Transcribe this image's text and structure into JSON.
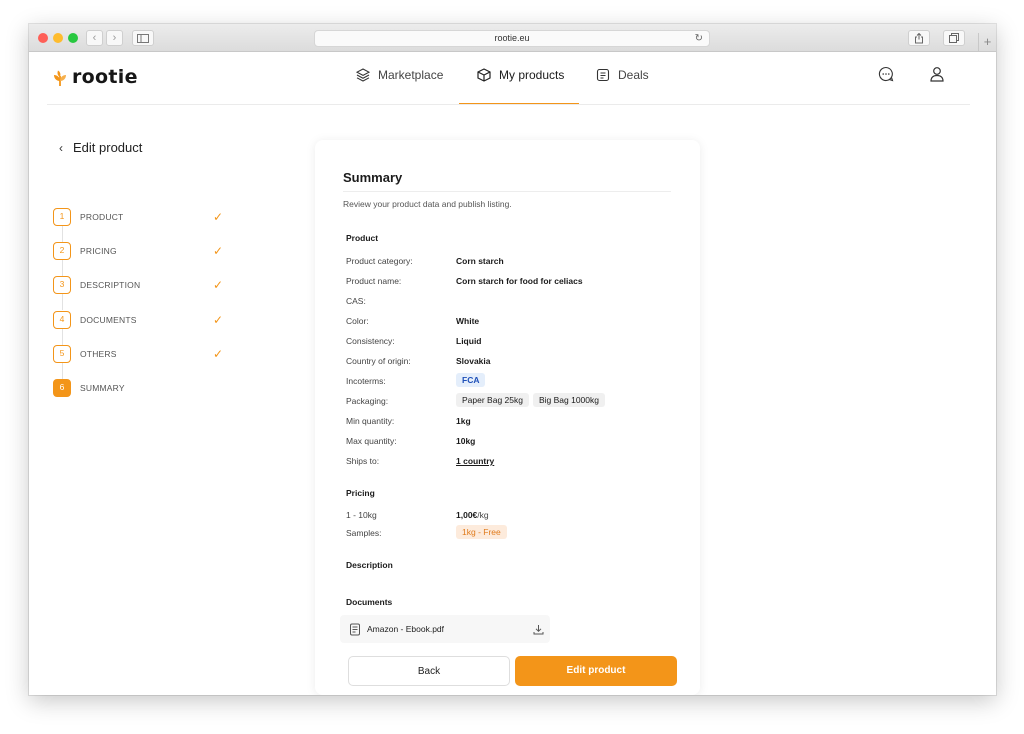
{
  "browser": {
    "url": "rootie.eu"
  },
  "header": {
    "logo_text": "rootie",
    "nav": [
      {
        "label": "Marketplace",
        "icon": "layers-icon"
      },
      {
        "label": "My products",
        "icon": "box-icon",
        "active": true
      },
      {
        "label": "Deals",
        "icon": "document-icon"
      }
    ],
    "accent_color": "#f39519"
  },
  "sidebar": {
    "back_label": "Edit product",
    "steps": [
      {
        "number": "1",
        "label": "PRODUCT",
        "done": true
      },
      {
        "number": "2",
        "label": "PRICING",
        "done": true
      },
      {
        "number": "3",
        "label": "DESCRIPTION",
        "done": true
      },
      {
        "number": "4",
        "label": "DOCUMENTS",
        "done": true
      },
      {
        "number": "5",
        "label": "OTHERS",
        "done": true
      },
      {
        "number": "6",
        "label": "SUMMARY",
        "done": false,
        "active": true
      }
    ]
  },
  "summary": {
    "title": "Summary",
    "subtitle": "Review your product data and publish listing.",
    "product_section": "Product",
    "product": {
      "category_label": "Product category:",
      "category_value": "Corn starch",
      "name_label": "Product name:",
      "name_value": "Corn starch for food for celiacs",
      "cas_label": "CAS:",
      "color_label": "Color:",
      "color_value": "White",
      "consistency_label": "Consistency:",
      "consistency_value": "Liquid",
      "origin_label": "Country of origin:",
      "origin_value": "Slovakia",
      "incoterms_label": "Incoterms:",
      "incoterms_value": "FCA",
      "packaging_label": "Packaging:",
      "packaging_values": [
        "Paper Bag 25kg",
        "Big Bag 1000kg"
      ],
      "min_qty_label": "Min quantity:",
      "min_qty_value": "1kg",
      "max_qty_label": "Max quantity:",
      "max_qty_value": "10kg",
      "ships_label": "Ships to:",
      "ships_value": "1 country"
    },
    "pricing_section": "Pricing",
    "pricing": {
      "range_label": "1 - 10kg",
      "range_price": "1,00€",
      "range_unit": "/kg",
      "samples_label": "Samples:",
      "samples_value": "1kg - Free"
    },
    "description_section": "Description",
    "documents_section": "Documents",
    "documents": [
      {
        "name": "Amazon - Ebook.pdf"
      }
    ]
  },
  "footer": {
    "back_label": "Back",
    "edit_label": "Edit product"
  }
}
